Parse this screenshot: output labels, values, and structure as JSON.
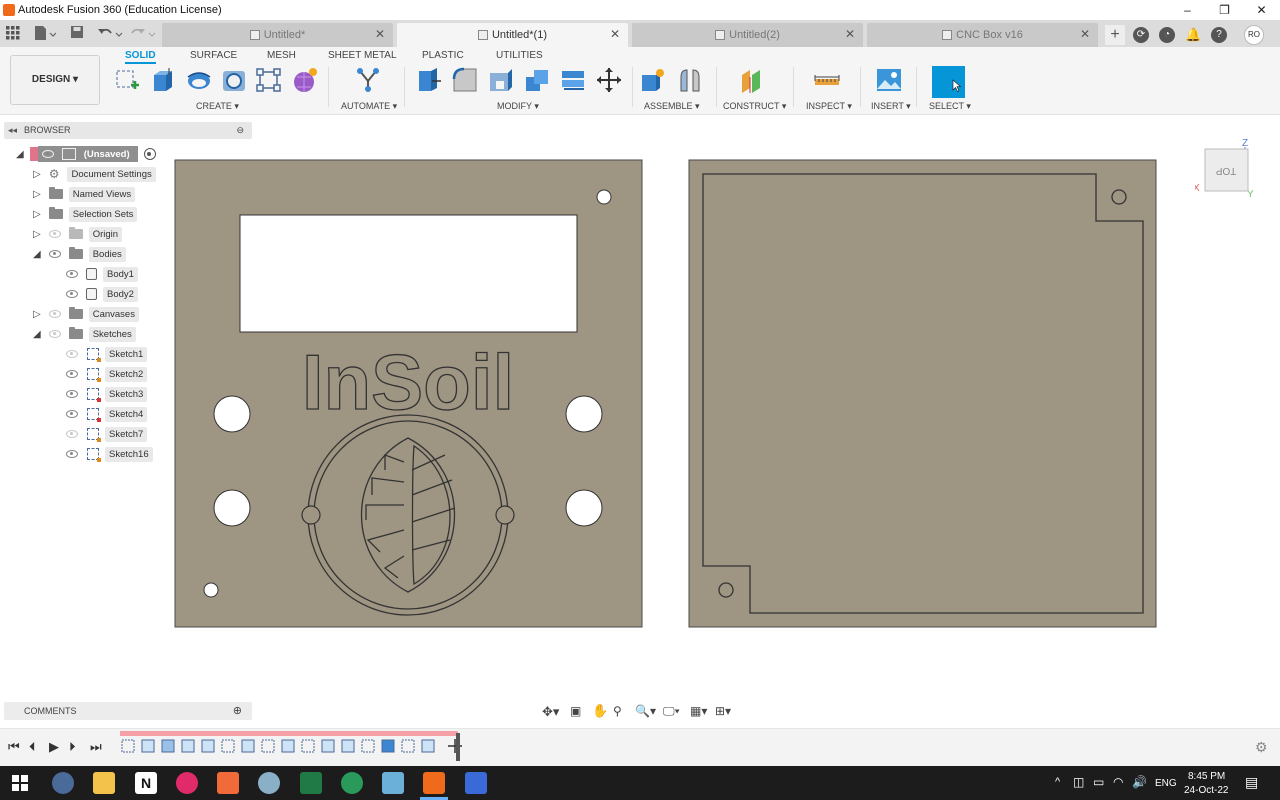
{
  "window": {
    "title": "Autodesk Fusion 360 (Education License)",
    "controls": [
      "–",
      "❐",
      "✕"
    ]
  },
  "tabs": [
    {
      "label": "Untitled*",
      "active": false
    },
    {
      "label": "Untitled*(1)",
      "active": true
    },
    {
      "label": "Untitled(2)",
      "active": false
    },
    {
      "label": "CNC Box v16",
      "active": false
    }
  ],
  "user_initials": "RO",
  "ribbon": {
    "workspace": "DESIGN",
    "tabs": [
      "SOLID",
      "SURFACE",
      "MESH",
      "SHEET METAL",
      "PLASTIC",
      "UTILITIES"
    ],
    "active_tab": "SOLID",
    "groups": [
      "CREATE ▾",
      "AUTOMATE ▾",
      "MODIFY ▾",
      "ASSEMBLE ▾",
      "CONSTRUCT ▾",
      "INSPECT ▾",
      "INSERT ▾",
      "SELECT ▾"
    ]
  },
  "browser": {
    "header": "BROWSER",
    "root": "(Unsaved)",
    "items": [
      {
        "label": "Document Settings",
        "icon": "gear-icon"
      },
      {
        "label": "Named Views",
        "icon": "folder-icon"
      },
      {
        "label": "Selection Sets",
        "icon": "folder-icon"
      },
      {
        "label": "Origin",
        "icon": "folder-icon"
      },
      {
        "label": "Bodies",
        "icon": "folder-icon"
      },
      {
        "label": "Body1",
        "icon": "body-icon"
      },
      {
        "label": "Body2",
        "icon": "body-icon"
      },
      {
        "label": "Canvases",
        "icon": "folder-icon"
      },
      {
        "label": "Sketches",
        "icon": "folder-icon"
      },
      {
        "label": "Sketch1",
        "icon": "sketch-icon"
      },
      {
        "label": "Sketch2",
        "icon": "sketch-icon"
      },
      {
        "label": "Sketch3",
        "icon": "sketch-icon"
      },
      {
        "label": "Sketch4",
        "icon": "sketch-icon"
      },
      {
        "label": "Sketch7",
        "icon": "sketch-icon"
      },
      {
        "label": "Sketch16",
        "icon": "sketch-icon"
      }
    ]
  },
  "canvas": {
    "panel_text": "InSoil",
    "viewcube_label": "TOP",
    "axis_z": "Z",
    "axis_x": "X",
    "axis_y": "Y"
  },
  "comments": {
    "label": "COMMENTS"
  },
  "taskbar": {
    "language": "ENG",
    "time": "8:45 PM",
    "date": "24-Oct-22"
  },
  "colors": {
    "panel": "#9e9583",
    "accent": "#0696d7",
    "timeline_bar": "#f4a0a6"
  }
}
